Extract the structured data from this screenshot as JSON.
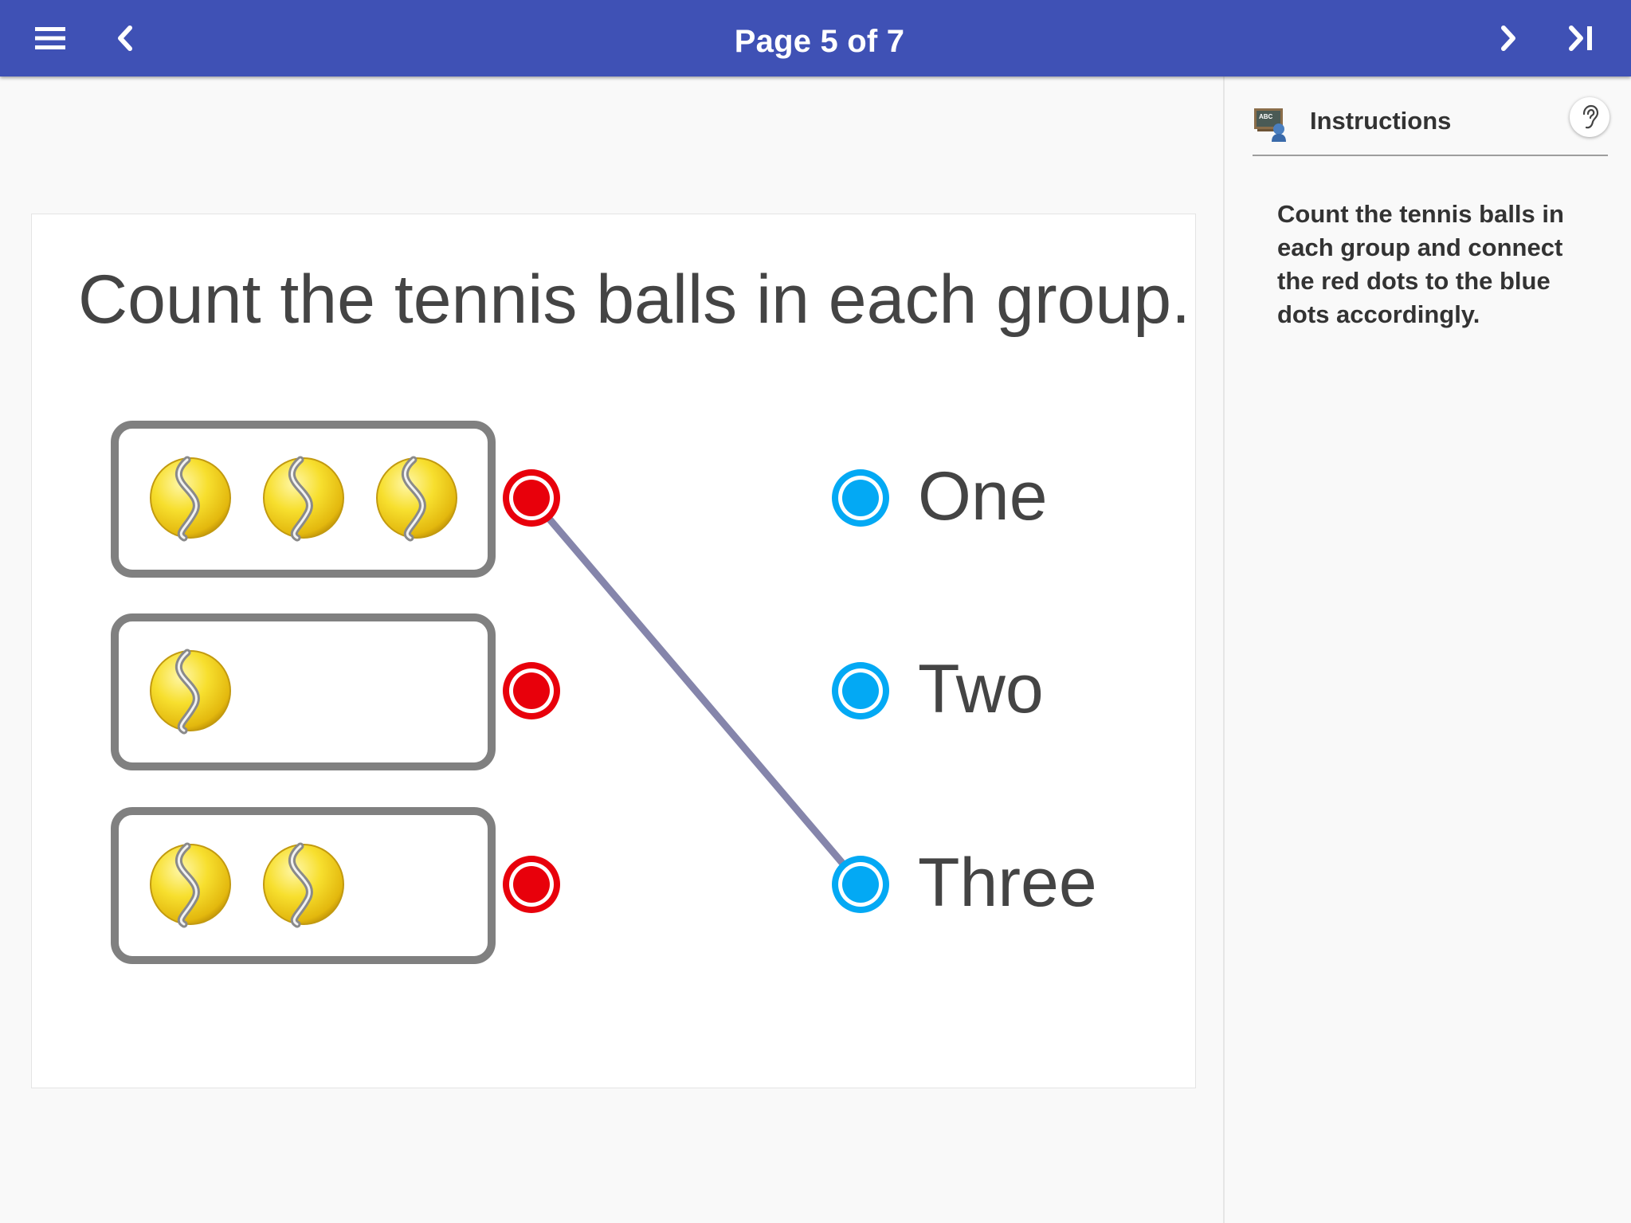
{
  "header": {
    "page_label": "Page 5 of 7",
    "menu_icon": "menu-icon",
    "back_icon": "chevron-left-icon",
    "next_icon": "chevron-right-icon",
    "last_icon": "skip-to-end-icon",
    "background": "#3f51b5"
  },
  "activity": {
    "question": "Count the tennis balls in each group.",
    "groups": [
      {
        "ball_count": 3
      },
      {
        "ball_count": 1
      },
      {
        "ball_count": 2
      }
    ],
    "answers": [
      {
        "label": "One"
      },
      {
        "label": "Two"
      },
      {
        "label": "Three"
      }
    ],
    "connections": [
      {
        "from_group": 1,
        "to_answer": 3
      }
    ],
    "colors": {
      "red_dot": "#e8000b",
      "blue_dot": "#03a9f4",
      "connector": "#8585ab",
      "group_border": "#808080"
    }
  },
  "sidebar": {
    "title": "Instructions",
    "header_icon": "teacher-board-icon",
    "listen_icon": "ear-icon",
    "text": "Count the tennis balls in each group and connect the red dots to the blue dots accordingly."
  }
}
